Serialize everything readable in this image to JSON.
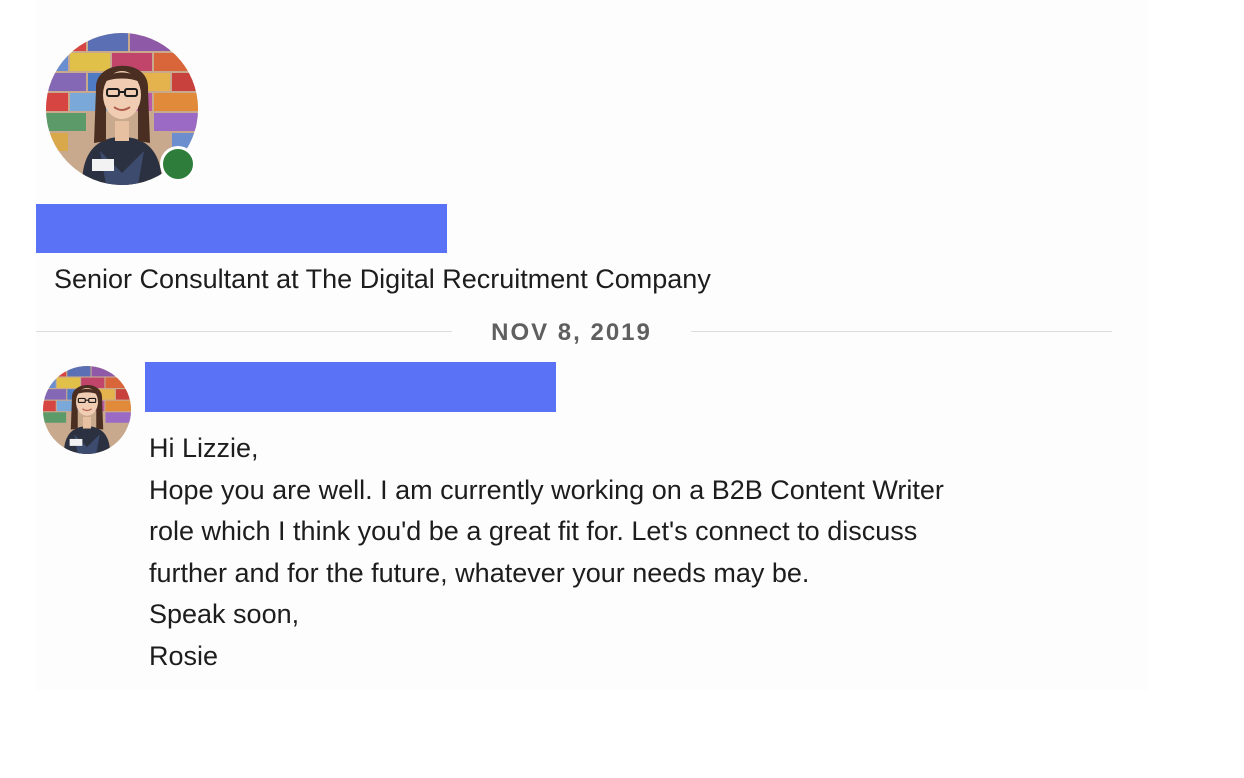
{
  "profile": {
    "avatar_icon": "profile-photo",
    "presence_status_color": "#2e7d3a",
    "headline": "Senior Consultant at The Digital Recruitment Company"
  },
  "conversation": {
    "date_divider": "NOV 8, 2019",
    "message": {
      "avatar_icon": "profile-photo",
      "lines": [
        "Hi Lizzie,",
        "Hope you are well. I am currently working on a B2B Content Writer",
        "role which I think you'd be a great fit for. Let's connect to discuss",
        "further and for the future, whatever your needs may be.",
        "Speak soon,",
        "Rosie"
      ]
    }
  },
  "colors": {
    "redaction": "#5a72f5",
    "divider": "#dcdcdc",
    "date_text": "#5f5f5f"
  }
}
